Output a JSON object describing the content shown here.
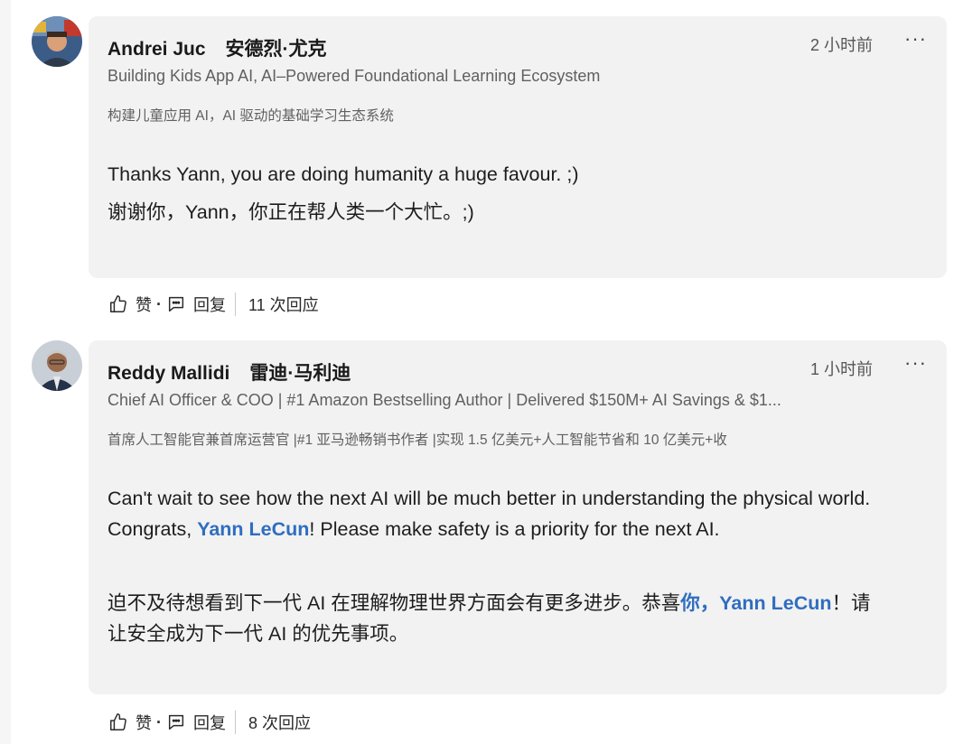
{
  "comments": [
    {
      "author_name": "Andrei Juc",
      "author_name_cn": "安德烈·尤克",
      "time": "2 小时前",
      "more": "···",
      "headline": "Building Kids App AI, AI–Powered Foundational Learning Ecosystem",
      "headline_cn": "构建儿童应用 AI，AI 驱动的基础学习生态系统",
      "text_en": "Thanks Yann, you are doing humanity a huge favour. ;)",
      "text_cn": "谢谢你，Yann，你正在帮人类一个大忙。;)",
      "like_label": "赞",
      "dot": "·",
      "reply_label": "回复",
      "reply_count": "11 次回应"
    },
    {
      "author_name": "Reddy Mallidi",
      "author_name_cn": "雷迪·马利迪",
      "time": "1 小时前",
      "more": "···",
      "headline": "Chief AI Officer & COO | #1 Amazon Bestselling Author | Delivered $150M+ AI Savings & $1...",
      "headline_cn": "首席人工智能官兼首席运营官 |#1 亚马逊畅销书作者 |实现 1.5 亿美元+人工智能节省和 10 亿美元+收",
      "text_en_1": "Can't wait to see how the next AI will be much better in understanding the physical world. Congrats, ",
      "mention_en": "Yann LeCun",
      "text_en_2": "! Please make safety is a priority for the next AI.",
      "text_cn_1": "迫不及待想看到下一代 AI 在理解物理世界方面会有更多进步。恭喜",
      "mention_cn": "你，Yann LeCun",
      "text_cn_2": "！请让安全成为下一代 AI 的优先事项。",
      "like_label": "赞",
      "dot": "·",
      "reply_label": "回复",
      "reply_count": "8 次回应"
    }
  ],
  "colors": {
    "bubble": "#f2f2f2",
    "mention": "#2f6ec0",
    "meta": "#606060"
  }
}
